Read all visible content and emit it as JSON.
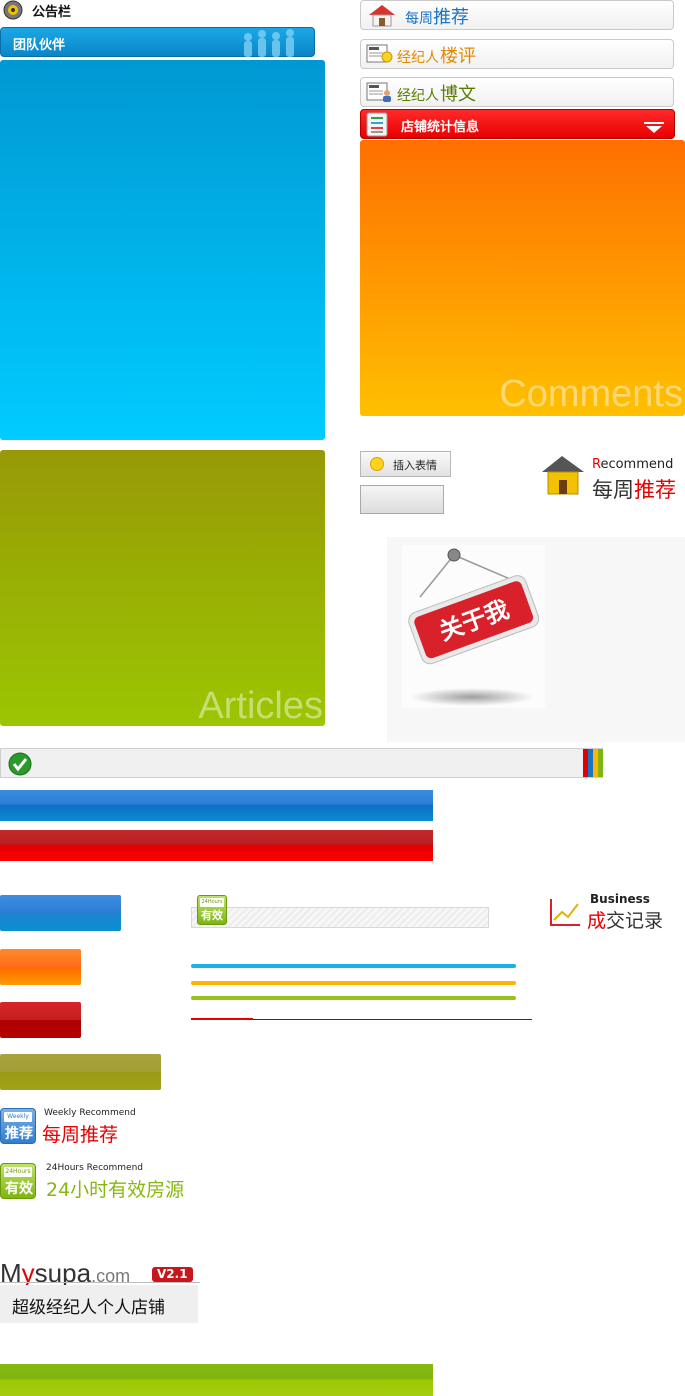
{
  "notice": {
    "label": "公告栏"
  },
  "team": {
    "label": "团队伙伴"
  },
  "panels": {
    "green_watermark": "Articles",
    "orange_watermark": "Comments"
  },
  "nav_buttons": [
    {
      "prefix": "每周",
      "suffix": "推荐",
      "prefix_color": "#1a74c6",
      "suffix_color": "#1a74c6"
    },
    {
      "prefix": "经纪人",
      "suffix": "楼评",
      "prefix_color": "#e08a00",
      "suffix_color": "#e08a00"
    },
    {
      "prefix": "经纪人",
      "suffix": "博文",
      "prefix_color": "#5a7d00",
      "suffix_color": "#5a7d00"
    }
  ],
  "stats": {
    "label": "店铺统计信息"
  },
  "emoji_button": {
    "label": "插入表情"
  },
  "recommend_logo": {
    "en_first": "R",
    "en_rest": "ecommend",
    "cn_plain": "每周",
    "cn_accent": "推荐"
  },
  "about_sign": {
    "label": "关于我"
  },
  "business_logo": {
    "en": "Business",
    "cn_accent": "成",
    "cn_plain": "交记录"
  },
  "valid_badge": {
    "top": "24Hours",
    "bottom": "有效"
  },
  "weekly_logo": {
    "badge_top": "Weekly",
    "badge_bottom": "推荐",
    "en": "Weekly Recommend",
    "cn_plain": "每周",
    "cn_accent": "推荐"
  },
  "hours_logo": {
    "badge_top": "24Hours",
    "badge_bottom": "有效",
    "en": "24Hours  Recommend",
    "cn": "24小时有效房源"
  },
  "mysupa": {
    "m": "M",
    "y": "y",
    "rest": "supa",
    "domain": ".com",
    "version": "V2.1",
    "tagline": "超级经纪人个人店铺"
  },
  "colors": {
    "blue": "#0b86c8",
    "red": "#e60000",
    "orange": "#ff8a00",
    "green": "#9bc602",
    "olive": "#a1a21a"
  }
}
